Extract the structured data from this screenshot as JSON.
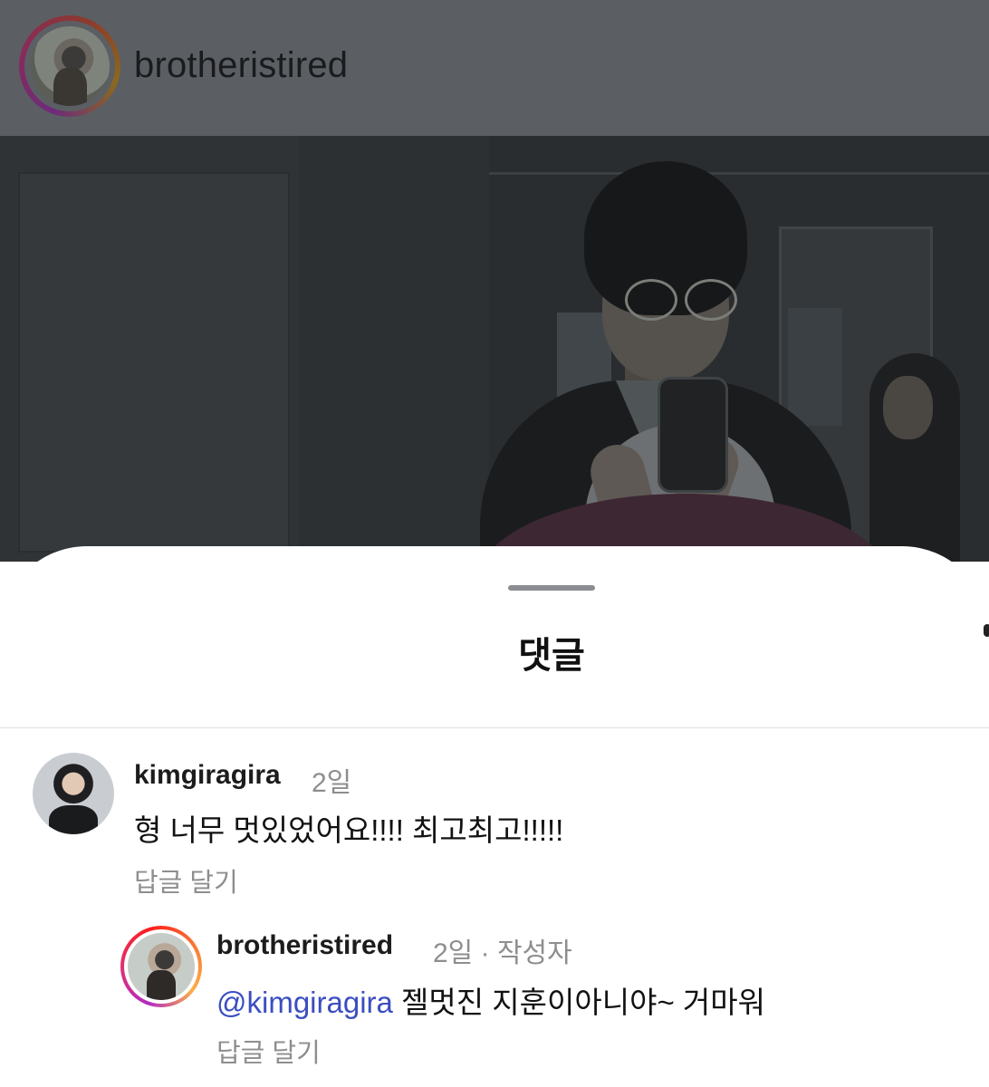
{
  "post": {
    "username": "brotheristired"
  },
  "sheet": {
    "title": "댓글"
  },
  "comments": [
    {
      "username": "kimgiragira",
      "time": "2일",
      "text": "형 너무 멋있었어요!!!! 최고최고!!!!!",
      "reply_label": "답글 달기"
    },
    {
      "username": "brotheristired",
      "time": "2일",
      "author_tag": " · 작성자",
      "mention": "@kimgiragira",
      "text": " 젤멋진 지훈이아니야~ 거마워",
      "reply_label": "답글 달기"
    }
  ],
  "colors": {
    "mention": "#3b4ec0",
    "secondary_text": "#8e8e8e",
    "overlay": "#5b5f64"
  }
}
